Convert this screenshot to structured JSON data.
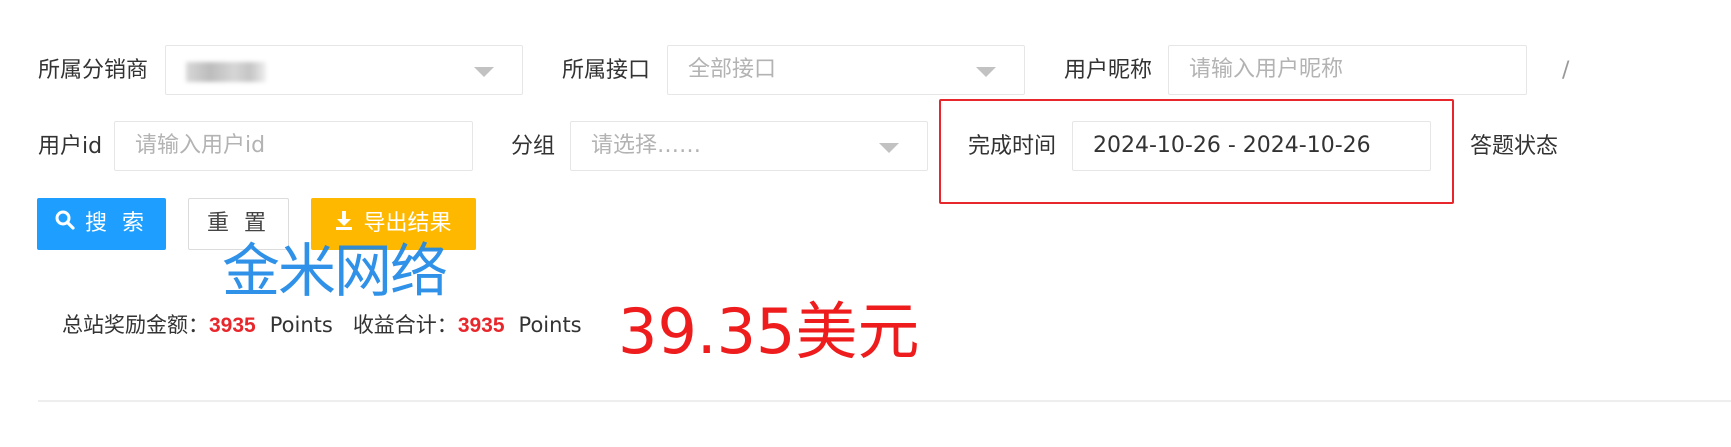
{
  "filters": {
    "distributor": {
      "label": "所属分销商"
    },
    "interface": {
      "label": "所属接口",
      "value": "全部接口"
    },
    "nickname": {
      "label": "用户昵称",
      "placeholder": "请输入用户昵称"
    },
    "overflow_char": "/",
    "user_id": {
      "label": "用户id",
      "placeholder": "请输入用户id"
    },
    "group": {
      "label": "分组",
      "placeholder": "请选择……"
    },
    "finish_time": {
      "label": "完成时间",
      "value": "2024-10-26 - 2024-10-26"
    },
    "answer_status": {
      "label": "答题状态"
    }
  },
  "buttons": {
    "search": "搜 索",
    "reset": "重 置",
    "export": "导出结果"
  },
  "watermark": "金米网络",
  "stats": {
    "total_reward_label": "总站奖励金额：",
    "total_reward_value": "3935",
    "total_reward_unit": "Points",
    "income_label": "收益合计：",
    "income_value": "3935",
    "income_unit": "Points"
  },
  "annotation_amount": "39.35美元",
  "colors": {
    "primary": "#1e9fff",
    "warning": "#ffb800",
    "highlight": "#e8272c",
    "stat_value": "#e8272c",
    "watermark": "#1e88e5"
  },
  "icons": {
    "search_button_icon": "search-icon",
    "export_button_icon": "download-icon",
    "select_caret": "caret-down-icon"
  }
}
